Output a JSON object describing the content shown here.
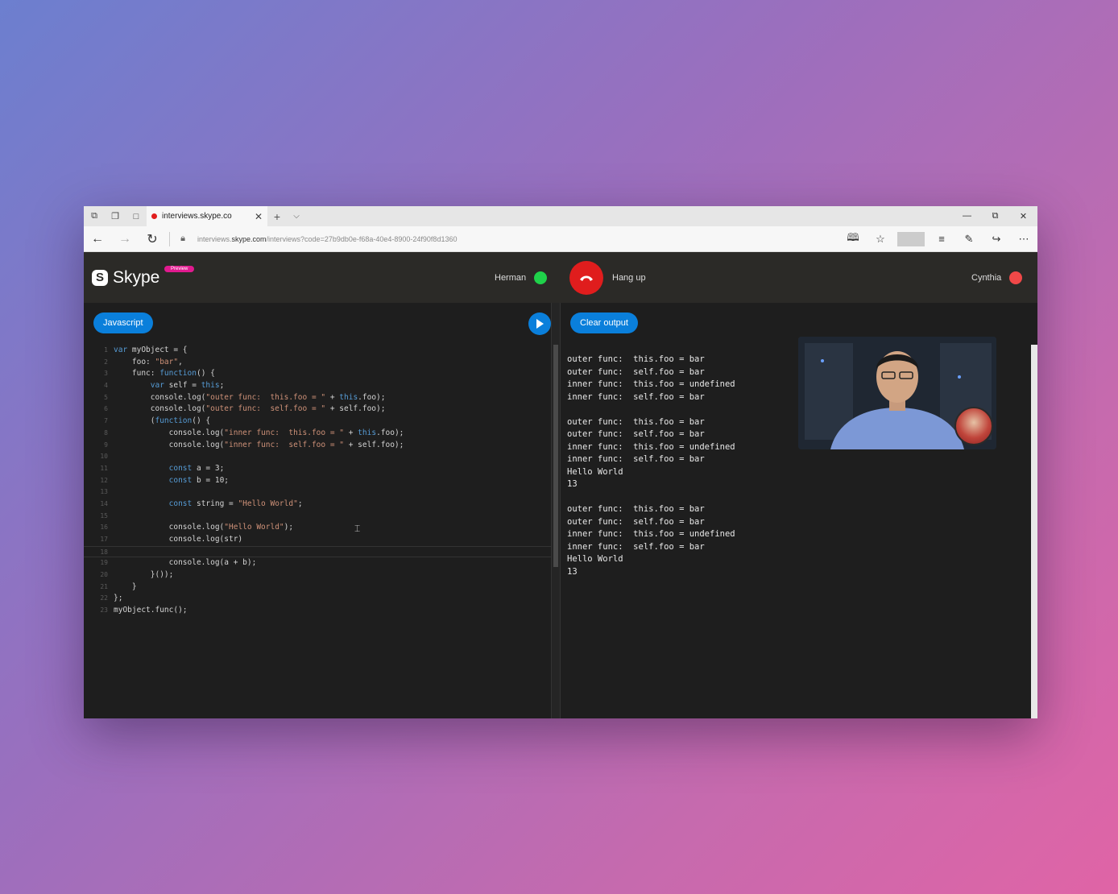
{
  "browser": {
    "tab_title": "interviews.skype.co",
    "url_prefix": "interviews.",
    "url_domain": "skype.com",
    "url_rest": "/interviews?code=27b9db0e-f68a-40e4-8900-24f90f8d1360"
  },
  "header": {
    "logo_text": "Skype",
    "badge": "Preview",
    "left_participant": "Herman",
    "left_status_color": "#1fd14a",
    "hangup_label": "Hang up",
    "right_participant": "Cynthia",
    "right_status_color": "#f04848"
  },
  "editor": {
    "language_button": "Javascript",
    "lines": [
      {
        "n": "1",
        "t": "var myObject = {"
      },
      {
        "n": "2",
        "t": "    foo: \"bar\","
      },
      {
        "n": "3",
        "t": "    func: function() {"
      },
      {
        "n": "4",
        "t": "        var self = this;"
      },
      {
        "n": "5",
        "t": "        console.log(\"outer func:  this.foo = \" + this.foo);"
      },
      {
        "n": "6",
        "t": "        console.log(\"outer func:  self.foo = \" + self.foo);"
      },
      {
        "n": "7",
        "t": "        (function() {"
      },
      {
        "n": "8",
        "t": "            console.log(\"inner func:  this.foo = \" + this.foo);"
      },
      {
        "n": "9",
        "t": "            console.log(\"inner func:  self.foo = \" + self.foo);"
      },
      {
        "n": "10",
        "t": ""
      },
      {
        "n": "11",
        "t": "            const a = 3;"
      },
      {
        "n": "12",
        "t": "            const b = 10;"
      },
      {
        "n": "13",
        "t": ""
      },
      {
        "n": "14",
        "t": "            const string = \"Hello World\";"
      },
      {
        "n": "15",
        "t": ""
      },
      {
        "n": "16",
        "t": "            console.log(\"Hello World\");"
      },
      {
        "n": "17",
        "t": "            console.log(str)"
      },
      {
        "n": "18",
        "t": ""
      },
      {
        "n": "19",
        "t": "            console.log(a + b);"
      },
      {
        "n": "20",
        "t": "        }());"
      },
      {
        "n": "21",
        "t": "    }"
      },
      {
        "n": "22",
        "t": "};"
      },
      {
        "n": "23",
        "t": "myObject.func();"
      }
    ]
  },
  "output": {
    "clear_button": "Clear output",
    "lines": [
      "outer func:  this.foo = bar",
      "outer func:  self.foo = bar",
      "inner func:  this.foo = undefined",
      "inner func:  self.foo = bar",
      "",
      "outer func:  this.foo = bar",
      "outer func:  self.foo = bar",
      "inner func:  this.foo = undefined",
      "inner func:  self.foo = bar",
      "Hello World",
      "13",
      "",
      "outer func:  this.foo = bar",
      "outer func:  self.foo = bar",
      "inner func:  this.foo = undefined",
      "inner func:  self.foo = bar",
      "Hello World",
      "13"
    ]
  }
}
